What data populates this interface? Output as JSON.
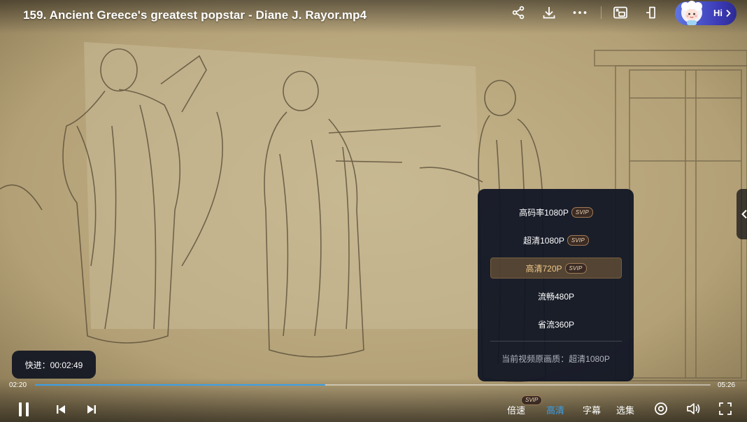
{
  "title": "159. Ancient Greece's greatest popstar - Diane J. Rayor.mp4",
  "top_icons": [
    "share-icon",
    "download-icon",
    "more-icon",
    "picture-in-picture-icon",
    "mini-window-icon"
  ],
  "hi_badge": {
    "text": "Hi"
  },
  "quality_menu": {
    "items": [
      {
        "label": "高码率1080P",
        "badge": "SVIP",
        "selected": false
      },
      {
        "label": "超清1080P",
        "badge": "SVIP",
        "selected": false
      },
      {
        "label": "高清720P",
        "badge": "SVIP",
        "selected": true
      },
      {
        "label": "流畅480P",
        "badge": "",
        "selected": false
      },
      {
        "label": "省流360P",
        "badge": "",
        "selected": false
      }
    ],
    "original_quality": "当前视频原画质：超清1080P"
  },
  "seek_toast": "快进：00:02:49",
  "progress": {
    "current": "02:20",
    "total": "05:26",
    "fraction": 0.4294
  },
  "controls": {
    "speed": "倍速",
    "speed_badge": "SVIP",
    "quality": "高清",
    "subtitles": "字幕",
    "episodes": "选集"
  },
  "colors": {
    "accent": "#3aa0e8",
    "panel_bg": "#101524",
    "selected_text": "#f0c98a",
    "hi_badge": "#3c3bb7"
  }
}
